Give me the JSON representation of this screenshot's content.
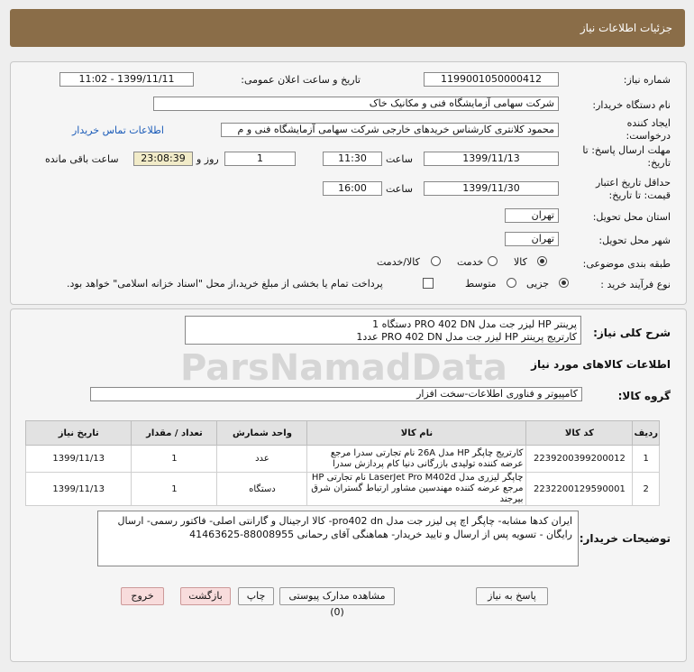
{
  "header": {
    "title": "جزئیات اطلاعات نیاز"
  },
  "form": {
    "need_number_label": "شماره نیاز:",
    "need_number": "1199001050000412",
    "announce_label": "تاریخ و ساعت اعلان عمومی:",
    "announce_value": "1399/11/11 - 11:02",
    "buyer_label": "نام دستگاه خریدار:",
    "buyer_value": "شرکت سهامی آزمایشگاه فنی و مکانیک خاک",
    "creator_label": "ایجاد کننده درخواست:",
    "creator_value": "محمود کلانتری کارشناس خریدهای خارجی  شرکت سهامی آزمایشگاه فنی و م",
    "contact_link": "اطلاعات تماس خریدار",
    "deadline_label": "مهلت ارسال پاسخ: تا تاریخ:",
    "deadline_date": "1399/11/13",
    "time_label": "ساعت",
    "deadline_time": "11:30",
    "days_value": "1",
    "days_label": "روز و",
    "remaining_time": "23:08:39",
    "remaining_label": "ساعت باقی مانده",
    "validity_label": "حداقل تاریخ اعتبار قیمت: تا تاریخ:",
    "validity_date": "1399/11/30",
    "validity_time_label": "ساعت",
    "validity_time": "16:00",
    "province_label": "استان محل تحویل:",
    "province_value": "تهران",
    "city_label": "شهر محل تحویل:",
    "city_value": "تهران",
    "category_label": "طبقه بندی موضوعی:",
    "category_options": [
      "کالا",
      "خدمت",
      "کالا/خدمت"
    ],
    "category_selected": "کالا",
    "process_label": "نوع فرآیند خرید :",
    "process_options": [
      "جزیی",
      "متوسط"
    ],
    "process_selected": "جزیی",
    "payment_note": "پرداخت تمام یا بخشی از مبلغ خرید،از محل \"اسناد خزانه اسلامی\" خواهد بود."
  },
  "summary": {
    "label": "شرح کلی نیاز:",
    "line1": "پرینتر HP لیزر جت مدل PRO 402 DN            دستگاه 1",
    "line2": "کارتریج پرینتر HP لیزر جت مدل PRO 402 DN        عدد1"
  },
  "goods": {
    "section_title": "اطلاعات کالاهای مورد نیاز",
    "group_label": "گروه کالا:",
    "group_value": "کامپیوتر و فناوری اطلاعات-سخت افزار",
    "columns": [
      "ردیف",
      "کد کالا",
      "نام کالا",
      "واحد شمارش",
      "تعداد / مقدار",
      "تاریخ نیاز"
    ],
    "rows": [
      {
        "idx": "1",
        "code": "2239200399200012",
        "name": "کارتریج چاپگر HP مدل 26A نام تجارتی سدرا مرجع عرضه کننده تولیدی بازرگانی دنیا کام پردازش سدرا",
        "unit": "عدد",
        "qty": "1",
        "date": "1399/11/13"
      },
      {
        "idx": "2",
        "code": "2232200129590001",
        "name": "چاپگر لیزری مدل LaserJet Pro M402d نام تجارتی HP مرجع عرضه کننده مهندسین مشاور ارتباط گستران شرق بیرجند",
        "unit": "دستگاه",
        "qty": "1",
        "date": "1399/11/13"
      }
    ]
  },
  "notes": {
    "label": "توضیحات خریدار:",
    "text": "ایران کدها مشابه- چاپگر اچ پی لیزر جت مدل pro402 dn- کالا ارجینال و گارانتی اصلی- فاکتور رسمی- ارسال رایگان - تسویه پس از ارسال و تایید خریدار- هماهنگی آقای رحمانی 88008955-41463625"
  },
  "buttons": {
    "reply": "پاسخ به نیاز",
    "view_docs": "مشاهده مدارک پیوستی (0)",
    "print": "چاپ",
    "back": "بازگشت",
    "exit": "خروج"
  },
  "watermark": {
    "brand": "ParsNamadData"
  }
}
